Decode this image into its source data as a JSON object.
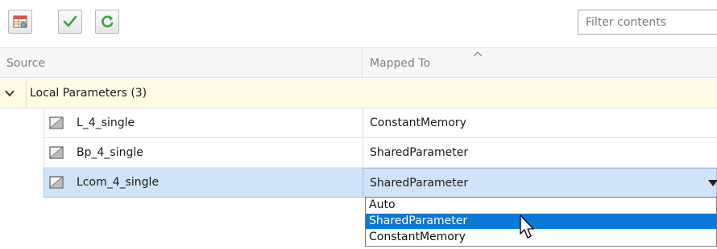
{
  "toolbar": {
    "buttons": [
      {
        "icon": "table-settings-icon"
      },
      {
        "icon": "checkmark-icon"
      },
      {
        "icon": "refresh-icon"
      }
    ],
    "filter_placeholder": "Filter contents"
  },
  "columns": {
    "source": "Source",
    "mapped_to": "Mapped To"
  },
  "group": {
    "label": "Local Parameters (3)",
    "expanded": true
  },
  "rows": [
    {
      "name": "L_4_single",
      "mapped": "ConstantMemory",
      "selected": false
    },
    {
      "name": "Bp_4_single",
      "mapped": "SharedParameter",
      "selected": false
    },
    {
      "name": "Lcom_4_single",
      "mapped": "SharedParameter",
      "selected": true
    }
  ],
  "dropdown": {
    "options": [
      "Auto",
      "SharedParameter",
      "ConstantMemory"
    ],
    "highlighted": "SharedParameter"
  },
  "colors": {
    "selection": "#cfe4f8",
    "highlight": "#0a78d7",
    "group_bg": "#fffbe5"
  }
}
